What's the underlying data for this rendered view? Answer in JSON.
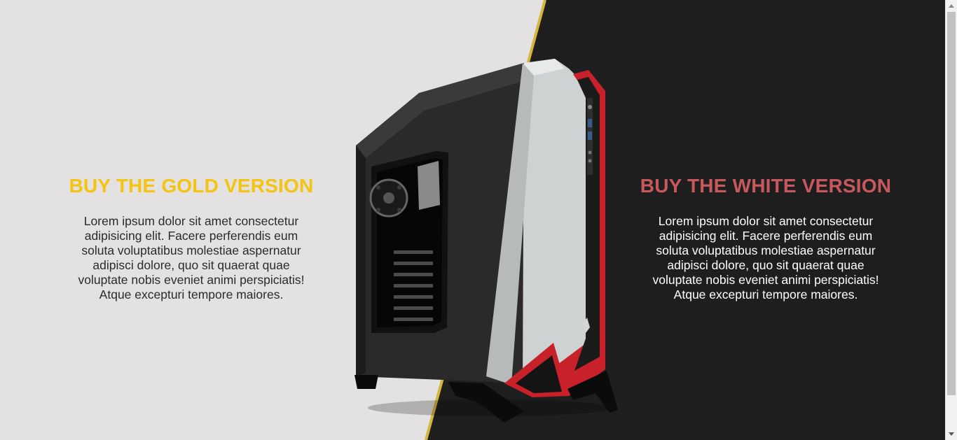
{
  "left": {
    "title": "BUY THE GOLD VERSION",
    "body": "Lorem ipsum dolor sit amet consectetur adipisicing elit. Facere perferendis eum soluta voluptatibus molestiae aspernatur adipisci dolore, quo sit quaerat quae voluptate nobis eveniet animi perspiciatis! Atque excepturi tempore maiores."
  },
  "right": {
    "title": "BUY THE WHITE VERSION",
    "body": "Lorem ipsum dolor sit amet consectetur adipisicing elit. Facere perferendis eum soluta voluptatibus molestiae aspernatur adipisci dolore, quo sit quaerat quae voluptate nobis eveniet animi perspiciatis! Atque excepturi tempore maiores."
  },
  "product": {
    "icon": "pc-case-image"
  },
  "colors": {
    "left_bg": "#e3e1e2",
    "right_bg": "#1f1e1f",
    "divider": "#d6b53a",
    "gold_title": "#f5c410",
    "white_title": "#c7585d"
  }
}
